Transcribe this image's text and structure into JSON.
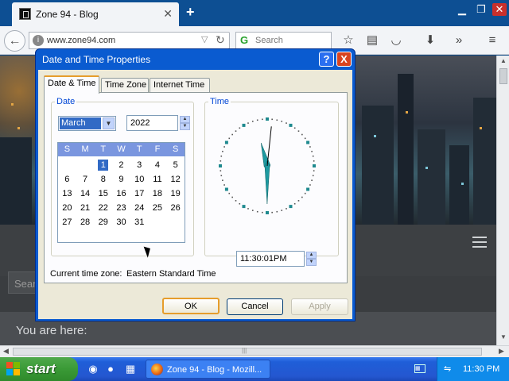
{
  "browser": {
    "tab_title": "Zone 94 - Blog",
    "url": "www.zone94.com",
    "search_placeholder": "Search"
  },
  "page": {
    "search_hint": "Sear",
    "breadcrumb_label": "You are here:"
  },
  "dialog": {
    "title": "Date and Time Properties",
    "help_label": "?",
    "close_label": "X",
    "tabs": [
      "Date & Time",
      "Time Zone",
      "Internet Time"
    ],
    "date_group_label": "Date",
    "time_group_label": "Time",
    "month": "March",
    "year": "2022",
    "weekdays": [
      "S",
      "M",
      "T",
      "W",
      "T",
      "F",
      "S"
    ],
    "calendar": [
      [
        "",
        "",
        "1",
        "2",
        "3",
        "4",
        "5"
      ],
      [
        "6",
        "7",
        "8",
        "9",
        "10",
        "11",
        "12"
      ],
      [
        "13",
        "14",
        "15",
        "16",
        "17",
        "18",
        "19"
      ],
      [
        "20",
        "21",
        "22",
        "23",
        "24",
        "25",
        "26"
      ],
      [
        "27",
        "28",
        "29",
        "30",
        "31",
        "",
        ""
      ]
    ],
    "selected_day": "1",
    "time_value": "11:30:01PM",
    "clock": {
      "hours": 11,
      "minutes": 30,
      "seconds": 1
    },
    "timezone_label": "Current time zone:",
    "timezone_value": "Eastern Standard Time",
    "buttons": {
      "ok": "OK",
      "cancel": "Cancel",
      "apply": "Apply"
    }
  },
  "taskbar": {
    "start_label": "start",
    "task_label": "Zone 94 - Blog - Mozill...",
    "clock": "11:30 PM"
  },
  "colors": {
    "accent": "#0a5bd0",
    "selection": "#316ac5",
    "calendar_header": "#7a96df"
  }
}
